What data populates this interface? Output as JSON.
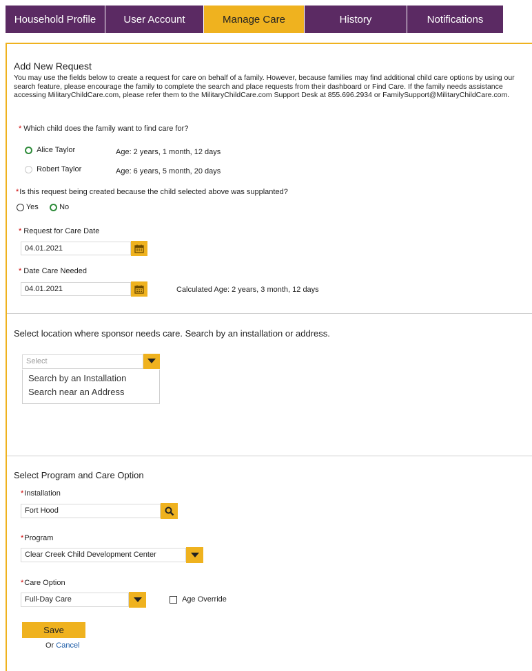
{
  "tabs": [
    {
      "label": "Household Profile"
    },
    {
      "label": "User Account"
    },
    {
      "label": "Manage Care"
    },
    {
      "label": "History"
    },
    {
      "label": "Notifications"
    }
  ],
  "active_tab": "Manage Care",
  "form": {
    "title": "Add New Request",
    "intro": "You may use the fields below to create a request for care on behalf of a family.  However, because families may find additional child care options by using our search feature, please encourage the family to complete the search and place requests from their dashboard or Find Care.  If the family needs assistance accessing MilitaryChildCare.com, please refer them to the MilitaryChildCare.com Support Desk at 855.696.2934 or FamilySupport@MilitaryChildCare.com.",
    "child_question": "Which child does the family want to find care for?",
    "children": [
      {
        "name": "Alice Taylor",
        "age": "Age: 2 years, 1 month, 12 days",
        "selected": true
      },
      {
        "name": "Robert Taylor",
        "age": "Age: 6 years, 5 month, 20 days",
        "selected": false
      }
    ],
    "supplanted_question": "Is this request being created because the child selected above was supplanted?",
    "yes_label": "Yes",
    "no_label": "No",
    "supplanted_value": "No",
    "request_date_label": "Request for Care Date",
    "request_date_value": "04.01.2021",
    "date_needed_label": "Date Care Needed",
    "date_needed_value": "04.01.2021",
    "calculated_age": "Calculated Age: 2 years, 3 month, 12 days"
  },
  "location": {
    "heading": "Select location where sponsor needs care. Search by an installation or address.",
    "select_placeholder": "Select",
    "options": [
      "Search by an Installation",
      "Search near an Address"
    ]
  },
  "program_section": {
    "heading": "Select Program and Care Option",
    "installation_label": "Installation",
    "installation_value": "Fort Hood",
    "program_label": "Program",
    "program_value": "Clear Creek Child Development Center",
    "care_option_label": "Care Option",
    "care_option_value": "Full-Day Care",
    "age_override_label": "Age Override",
    "age_override_checked": false,
    "save_label": "Save",
    "or_label": "Or",
    "cancel_label": "Cancel"
  },
  "colors": {
    "tab_purple": "#5b2a63",
    "accent_gold": "#efb21f",
    "required_red": "#cc0000",
    "radio_green": "#2e8b3a"
  }
}
